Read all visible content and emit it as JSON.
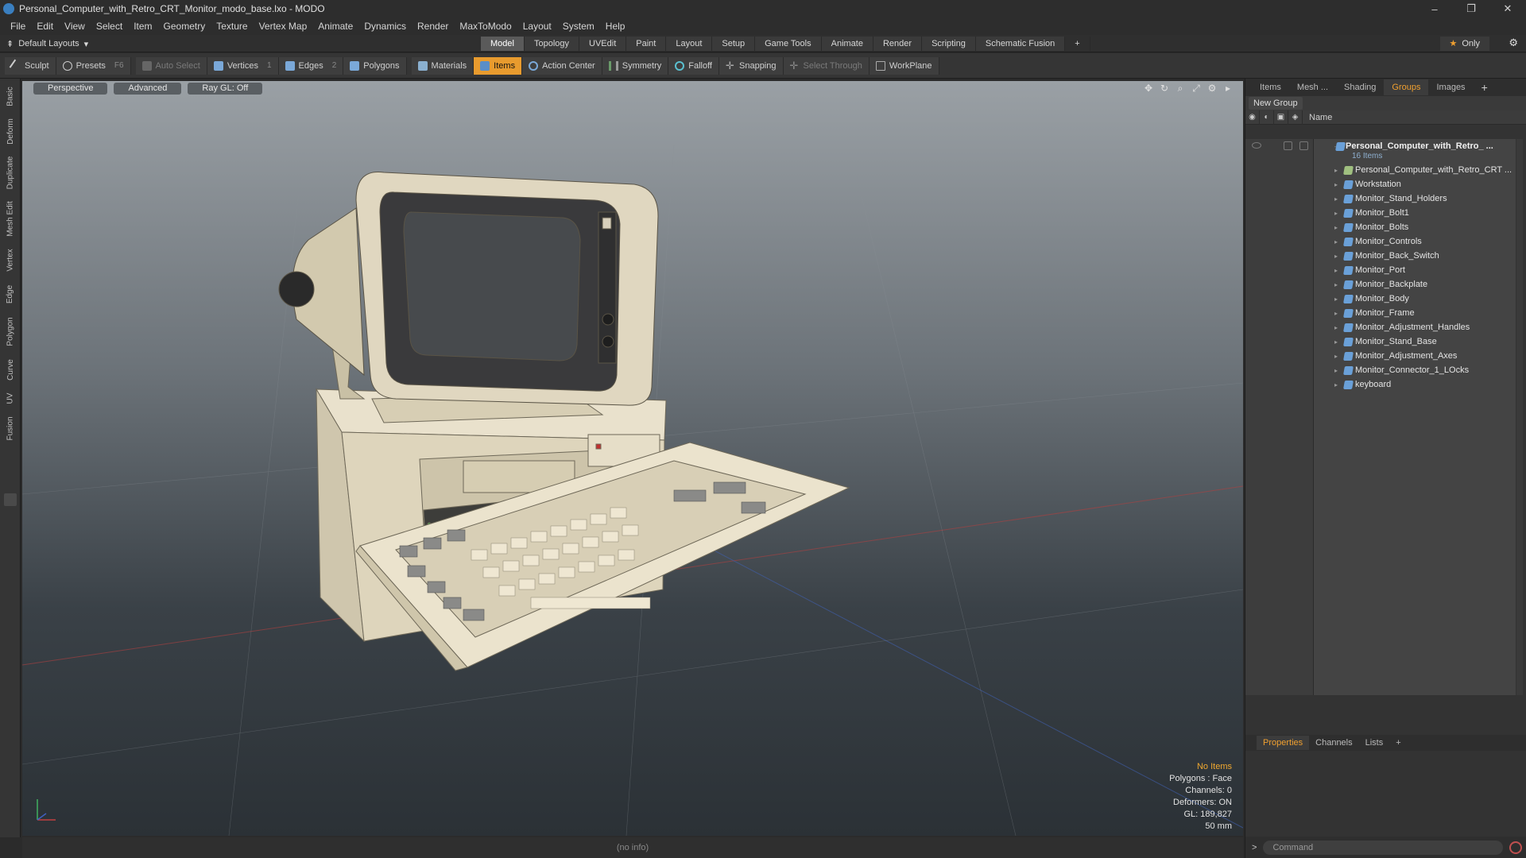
{
  "window": {
    "title": "Personal_Computer_with_Retro_CRT_Monitor_modo_base.lxo - MODO",
    "controls": [
      "–",
      "❐",
      "✕"
    ]
  },
  "menu": [
    "File",
    "Edit",
    "View",
    "Select",
    "Item",
    "Geometry",
    "Texture",
    "Vertex Map",
    "Animate",
    "Dynamics",
    "Render",
    "MaxToModo",
    "Layout",
    "System",
    "Help"
  ],
  "layout_bar": {
    "layouts_label": "Default Layouts",
    "tabs": [
      "Model",
      "Topology",
      "UVEdit",
      "Paint",
      "Layout",
      "Setup",
      "Game Tools",
      "Animate",
      "Render",
      "Scripting",
      "Schematic Fusion"
    ],
    "active_tab": "Model",
    "only_label": "Only",
    "accent": "#e89b2e"
  },
  "toolbar": {
    "sculpt": "Sculpt",
    "presets": "Presets",
    "presets_key": "F6",
    "auto_select": "Auto Select",
    "vertices": "Vertices",
    "vertices_key": "1",
    "edges": "Edges",
    "edges_key": "2",
    "polygons": "Polygons",
    "materials": "Materials",
    "items": "Items",
    "action_center": "Action Center",
    "symmetry": "Symmetry",
    "falloff": "Falloff",
    "snapping": "Snapping",
    "select_through": "Select Through",
    "workplane": "WorkPlane"
  },
  "left_tabs": [
    "Basic",
    "Deform",
    "Duplicate",
    "Mesh Edit",
    "Vertex",
    "Edge",
    "Polygon",
    "Curve",
    "UV",
    "Fusion"
  ],
  "viewport": {
    "view": "Perspective",
    "shading": "Advanced",
    "raygl": "Ray GL: Off",
    "stats": {
      "no_items": "No Items",
      "polygons": "Polygons : Face",
      "channels": "Channels: 0",
      "deformers": "Deformers: ON",
      "gl": "GL: 189,827",
      "focal": "50 mm"
    }
  },
  "info_bar": "(no info)",
  "right_panel": {
    "tabs": [
      "Items",
      "Mesh ...",
      "Shading",
      "Groups",
      "Images"
    ],
    "active_tab": "Groups",
    "new_group": "New Group",
    "column_name": "Name",
    "root": {
      "label": "Personal_Computer_with_Retro_ ...",
      "count": "16 Items"
    },
    "items": [
      "Personal_Computer_with_Retro_CRT ...",
      "Workstation",
      "Monitor_Stand_Holders",
      "Monitor_Bolt1",
      "Monitor_Bolts",
      "Monitor_Controls",
      "Monitor_Back_Switch",
      "Monitor_Port",
      "Monitor_Backplate",
      "Monitor_Body",
      "Monitor_Frame",
      "Monitor_Adjustment_Handles",
      "Monitor_Stand_Base",
      "Monitor_Adjustment_Axes",
      "Monitor_Connector_1_LOcks",
      "keyboard"
    ],
    "props_tabs": [
      "Properties",
      "Channels",
      "Lists"
    ],
    "props_active": "Properties",
    "command_placeholder": "Command"
  }
}
